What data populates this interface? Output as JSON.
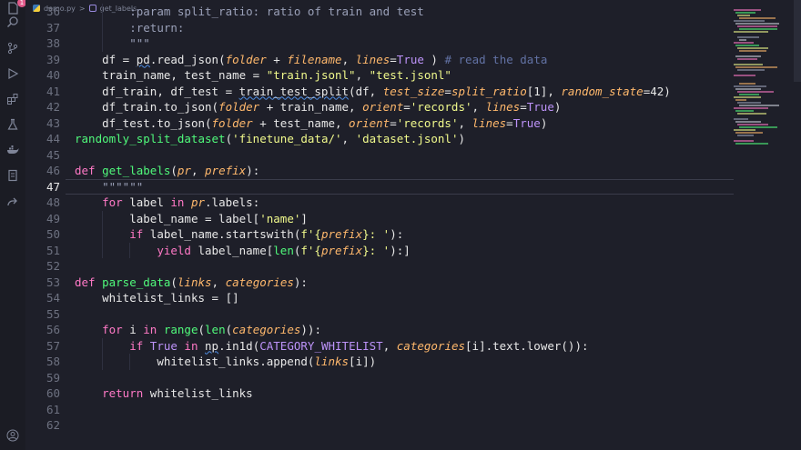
{
  "breadcrumb": {
    "file": "demo.py",
    "separator": ">",
    "symbol": "get_labels"
  },
  "activity": {
    "badge": "1"
  },
  "icons": [
    "explorer-icon",
    "search-icon",
    "source-control-icon",
    "run-debug-icon",
    "extensions-icon",
    "testing-icon",
    "docker-icon",
    "notebook-icon",
    "remote-icon",
    "account-icon"
  ],
  "editor": {
    "active_line": "47",
    "lines": [
      {
        "n": "36",
        "indent": 2,
        "tokens": [
          [
            "cm",
            ":param split_ratio: ratio of train and test"
          ]
        ]
      },
      {
        "n": "37",
        "indent": 2,
        "tokens": [
          [
            "cm",
            ":return:"
          ]
        ]
      },
      {
        "n": "38",
        "indent": 2,
        "tokens": [
          [
            "cm",
            "\"\"\""
          ]
        ]
      },
      {
        "n": "39",
        "indent": 1,
        "tokens": [
          [
            "",
            "df = "
          ],
          [
            "sq",
            "pd"
          ],
          [
            "",
            ".read_json("
          ],
          [
            "p",
            "folder"
          ],
          [
            "",
            " + "
          ],
          [
            "p",
            "filename"
          ],
          [
            "",
            ", "
          ],
          [
            "p",
            "lines"
          ],
          [
            "",
            "="
          ],
          [
            "n",
            "True"
          ],
          [
            "",
            " ) "
          ],
          [
            "c",
            "# read the data"
          ]
        ]
      },
      {
        "n": "40",
        "indent": 1,
        "tokens": [
          [
            "",
            "train_name, test_name = "
          ],
          [
            "s",
            "\"train.jsonl\""
          ],
          [
            "",
            ", "
          ],
          [
            "s",
            "\"test.jsonl\""
          ]
        ]
      },
      {
        "n": "41",
        "indent": 1,
        "tokens": [
          [
            "",
            "df_train, df_test = "
          ],
          [
            "sq",
            "train_test_split"
          ],
          [
            "",
            "(df, "
          ],
          [
            "p",
            "test_size"
          ],
          [
            "",
            "="
          ],
          [
            "p",
            "split_ratio"
          ],
          [
            "",
            "[1], "
          ],
          [
            "p",
            "random_state"
          ],
          [
            "",
            "=42)"
          ]
        ]
      },
      {
        "n": "42",
        "indent": 1,
        "tokens": [
          [
            "",
            "df_train.to_json("
          ],
          [
            "p",
            "folder"
          ],
          [
            "",
            " + train_name, "
          ],
          [
            "p",
            "orient"
          ],
          [
            "",
            "="
          ],
          [
            "s",
            "'records'"
          ],
          [
            "",
            ", "
          ],
          [
            "p",
            "lines"
          ],
          [
            "",
            "="
          ],
          [
            "n",
            "True"
          ],
          [
            "",
            ")"
          ]
        ]
      },
      {
        "n": "43",
        "indent": 1,
        "tokens": [
          [
            "",
            "df_test.to_json("
          ],
          [
            "p",
            "folder"
          ],
          [
            "",
            " + test_name, "
          ],
          [
            "p",
            "orient"
          ],
          [
            "",
            "="
          ],
          [
            "s",
            "'records'"
          ],
          [
            "",
            ", "
          ],
          [
            "p",
            "lines"
          ],
          [
            "",
            "="
          ],
          [
            "n",
            "True"
          ],
          [
            "",
            ")"
          ]
        ]
      },
      {
        "n": "44",
        "indent": 0,
        "tokens": [
          [
            "f",
            "randomly_split_dataset"
          ],
          [
            "",
            "("
          ],
          [
            "s",
            "'finetune_data/'"
          ],
          [
            "",
            ", "
          ],
          [
            "s",
            "'dataset.jsonl'"
          ],
          [
            "",
            ")"
          ]
        ]
      },
      {
        "n": "45",
        "indent": 0,
        "tokens": []
      },
      {
        "n": "46",
        "indent": 0,
        "tokens": [
          [
            "k",
            "def "
          ],
          [
            "f",
            "get_labels"
          ],
          [
            "",
            "("
          ],
          [
            "p",
            "pr"
          ],
          [
            "",
            ", "
          ],
          [
            "p",
            "prefix"
          ],
          [
            "",
            "):"
          ]
        ]
      },
      {
        "n": "47",
        "indent": 1,
        "tokens": [
          [
            "cm",
            "\"\"\"\"\"\""
          ]
        ]
      },
      {
        "n": "48",
        "indent": 1,
        "tokens": [
          [
            "k",
            "for "
          ],
          [
            "",
            "label "
          ],
          [
            "k",
            "in "
          ],
          [
            "p",
            "pr"
          ],
          [
            "",
            ".labels:"
          ]
        ]
      },
      {
        "n": "49",
        "indent": 2,
        "tokens": [
          [
            "",
            "label_name = label["
          ],
          [
            "s",
            "'name'"
          ],
          [
            "",
            "]"
          ]
        ]
      },
      {
        "n": "50",
        "indent": 2,
        "tokens": [
          [
            "k",
            "if "
          ],
          [
            "",
            "label_name.startswith("
          ],
          [
            "s",
            "f'{"
          ],
          [
            "p",
            "prefix"
          ],
          [
            "s",
            "}: '"
          ],
          [
            "",
            "):"
          ]
        ]
      },
      {
        "n": "51",
        "indent": 3,
        "tokens": [
          [
            "k",
            "yield "
          ],
          [
            "",
            "label_name["
          ],
          [
            "f",
            "len"
          ],
          [
            "",
            "("
          ],
          [
            "s",
            "f'{"
          ],
          [
            "p",
            "prefix"
          ],
          [
            "s",
            "}: '"
          ],
          [
            "",
            ")"
          ],
          [
            "",
            ":]"
          ]
        ]
      },
      {
        "n": "52",
        "indent": 0,
        "tokens": []
      },
      {
        "n": "53",
        "indent": 0,
        "tokens": [
          [
            "k",
            "def "
          ],
          [
            "f",
            "parse_data"
          ],
          [
            "",
            "("
          ],
          [
            "p",
            "links"
          ],
          [
            "",
            ", "
          ],
          [
            "p",
            "categories"
          ],
          [
            "",
            "):"
          ]
        ]
      },
      {
        "n": "54",
        "indent": 1,
        "tokens": [
          [
            "",
            "whitelist_links = []"
          ]
        ]
      },
      {
        "n": "55",
        "indent": 0,
        "tokens": []
      },
      {
        "n": "56",
        "indent": 1,
        "tokens": [
          [
            "k",
            "for "
          ],
          [
            "",
            "i "
          ],
          [
            "k",
            "in "
          ],
          [
            "f",
            "range"
          ],
          [
            "",
            "("
          ],
          [
            "f",
            "len"
          ],
          [
            "",
            "("
          ],
          [
            "p",
            "categories"
          ],
          [
            "",
            "))"
          ],
          [
            "",
            ":"
          ]
        ]
      },
      {
        "n": "57",
        "indent": 2,
        "tokens": [
          [
            "k",
            "if "
          ],
          [
            "n",
            "True"
          ],
          [
            "k",
            " in "
          ],
          [
            "sq",
            "np"
          ],
          [
            "",
            ".in1d("
          ],
          [
            "n",
            "CATEGORY_WHITELIST"
          ],
          [
            "",
            ", "
          ],
          [
            "p",
            "categories"
          ],
          [
            "",
            "[i].text.lower()):"
          ]
        ]
      },
      {
        "n": "58",
        "indent": 3,
        "tokens": [
          [
            "",
            "whitelist_links.append("
          ],
          [
            "p",
            "links"
          ],
          [
            "",
            "[i])"
          ]
        ]
      },
      {
        "n": "59",
        "indent": 0,
        "tokens": []
      },
      {
        "n": "60",
        "indent": 1,
        "tokens": [
          [
            "k",
            "return "
          ],
          [
            "",
            "whitelist_links"
          ]
        ]
      },
      {
        "n": "61",
        "indent": 0,
        "tokens": []
      },
      {
        "n": "62",
        "indent": 0,
        "tokens": []
      }
    ]
  },
  "colors": {
    "background": "#1e1f29",
    "keyword": "#ff79c6",
    "function": "#50fa7b",
    "string": "#f1fa8c",
    "param": "#ffb86c",
    "comment": "#6272a4",
    "constant": "#bd93f9"
  }
}
